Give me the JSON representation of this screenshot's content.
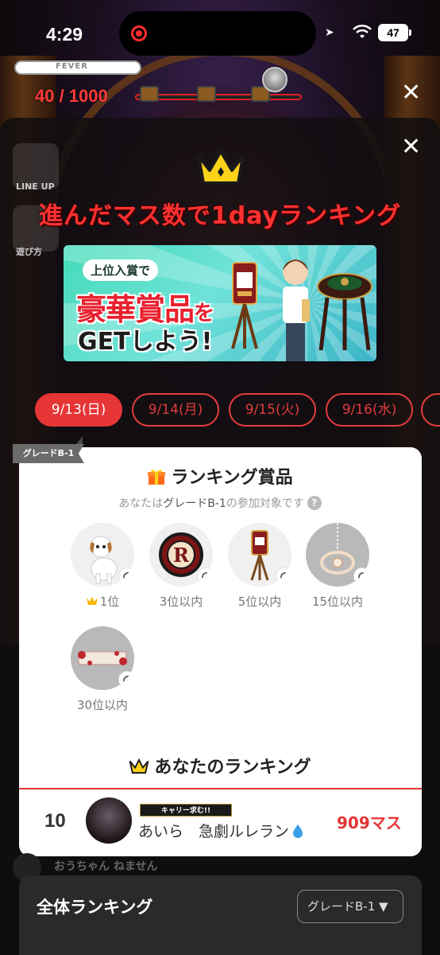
{
  "status_bar": {
    "time": "4:29",
    "battery": "47"
  },
  "game": {
    "fever_label": "FEVER",
    "progress": "40 / 1000"
  },
  "modal": {
    "title": "進んだマス数で1dayランキング",
    "banner": {
      "pill": "上位入賞で",
      "main": "豪華賞品",
      "main_suffix": "を",
      "sub": "GETしよう!"
    },
    "date_tabs": [
      {
        "label": "9/13(日)",
        "active": true
      },
      {
        "label": "9/14(月)",
        "active": false
      },
      {
        "label": "9/15(火)",
        "active": false
      },
      {
        "label": "9/16(水)",
        "active": false
      }
    ],
    "grade_ribbon": "グレードB-1",
    "prize_section": {
      "title": "ランキング賞品",
      "eligible_prefix": "あなたは",
      "eligible_grade": "グレードB-1",
      "eligible_suffix": "の参加対象です",
      "prizes": [
        {
          "label": "1位",
          "icon": "dog"
        },
        {
          "label": "3位以内",
          "icon": "emblem"
        },
        {
          "label": "5位以内",
          "icon": "slot-machine"
        },
        {
          "label": "15位以内",
          "icon": "necklace"
        },
        {
          "label": "30位以内",
          "icon": "nameplate"
        }
      ]
    },
    "my_ranking": {
      "title": "あなたのランキング",
      "rank": "10",
      "tag": "キャリー求む!!",
      "name": "あいら　急劇ルレラン",
      "score": "909マス"
    },
    "behind_user": "おうちゃん ねません",
    "overall": {
      "title": "全体ランキング",
      "grade_select": "グレードB-1 ▼"
    }
  },
  "side_buttons": {
    "lineup": "LINE UP",
    "howto": "遊び方"
  },
  "colors": {
    "accent": "#e63535",
    "title_red": "#ff3131",
    "banner_teal": "#44dbb8"
  }
}
